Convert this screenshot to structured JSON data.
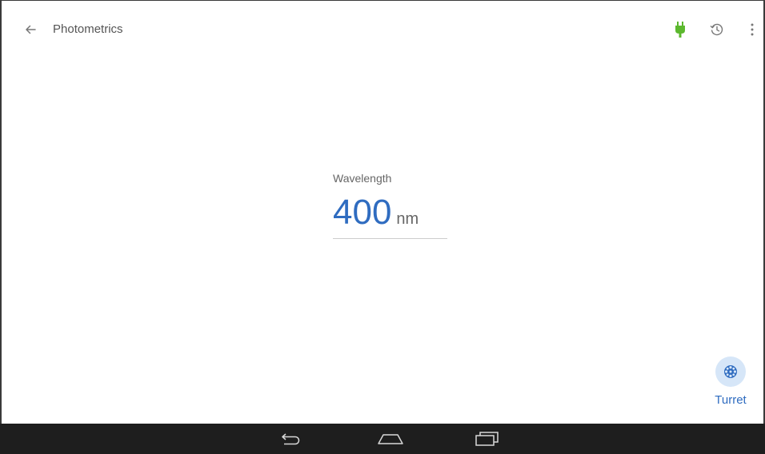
{
  "app_bar": {
    "title": "Photometrics",
    "icons": {
      "back": "arrow-left-icon",
      "power": "power-plug-icon",
      "history": "history-icon",
      "menu": "more-vert-icon"
    },
    "power_color": "#5cb82e"
  },
  "wavelength": {
    "label": "Wavelength",
    "value": "400",
    "unit": "nm"
  },
  "turret": {
    "label": "Turret",
    "icon": "turret-icon"
  },
  "nav_bar": {
    "icons": [
      "back-nav-icon",
      "home-nav-icon",
      "recents-nav-icon"
    ]
  },
  "colors": {
    "accent": "#2f6cc0",
    "turret_bg": "#d6e6f8",
    "nav_bg": "#1e1e1e"
  }
}
